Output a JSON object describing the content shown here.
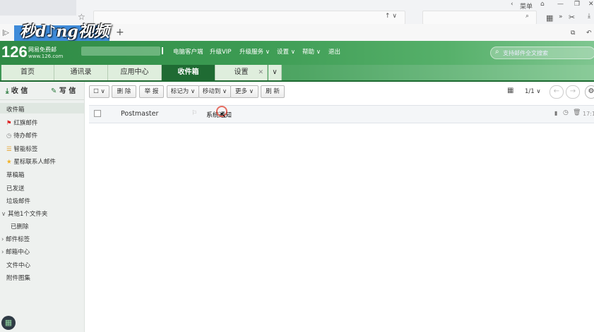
{
  "browser": {
    "watermark": "秒d♪ng视频",
    "top_right_label": "菜单",
    "address_text": "",
    "new_tab_symbol": "+",
    "search_text": ""
  },
  "header": {
    "logo_number": "126",
    "logo_name": "网易免费邮",
    "logo_url": "www.126.com",
    "links": [
      "电脑客户端",
      "升级VIP",
      "升级服务 ∨",
      "设置 ∨",
      "帮助 ∨",
      "退出"
    ],
    "search_placeholder": "支持邮件全文搜索"
  },
  "tabs": [
    {
      "label": "首页"
    },
    {
      "label": "通讯录"
    },
    {
      "label": "应用中心"
    },
    {
      "label": "收件箱"
    },
    {
      "label": "设置"
    }
  ],
  "sidebar": {
    "receive": "收 信",
    "compose": "写 信",
    "items": [
      {
        "label": "收件箱"
      },
      {
        "label": "红旗邮件"
      },
      {
        "label": "待办邮件"
      },
      {
        "label": "智能标签"
      },
      {
        "label": "星标联系人邮件"
      },
      {
        "label": "草稿箱"
      },
      {
        "label": "已发送"
      },
      {
        "label": "垃圾邮件"
      },
      {
        "label": "其他1个文件夹"
      },
      {
        "label": "已删除"
      },
      {
        "label": "邮件标签"
      },
      {
        "label": "邮箱中心"
      },
      {
        "label": "文件中心"
      },
      {
        "label": "附件图集"
      }
    ]
  },
  "toolbar": {
    "delete": "删 除",
    "report": "举 报",
    "mark_as": "标记为 ∨",
    "move_to": "移动到 ∨",
    "more": "更多 ∨",
    "refresh": "刷 新",
    "page": "1/1 ∨"
  },
  "mail_list": [
    {
      "sender": "Postmaster",
      "subject": "系统通知",
      "time": "17:1"
    }
  ]
}
